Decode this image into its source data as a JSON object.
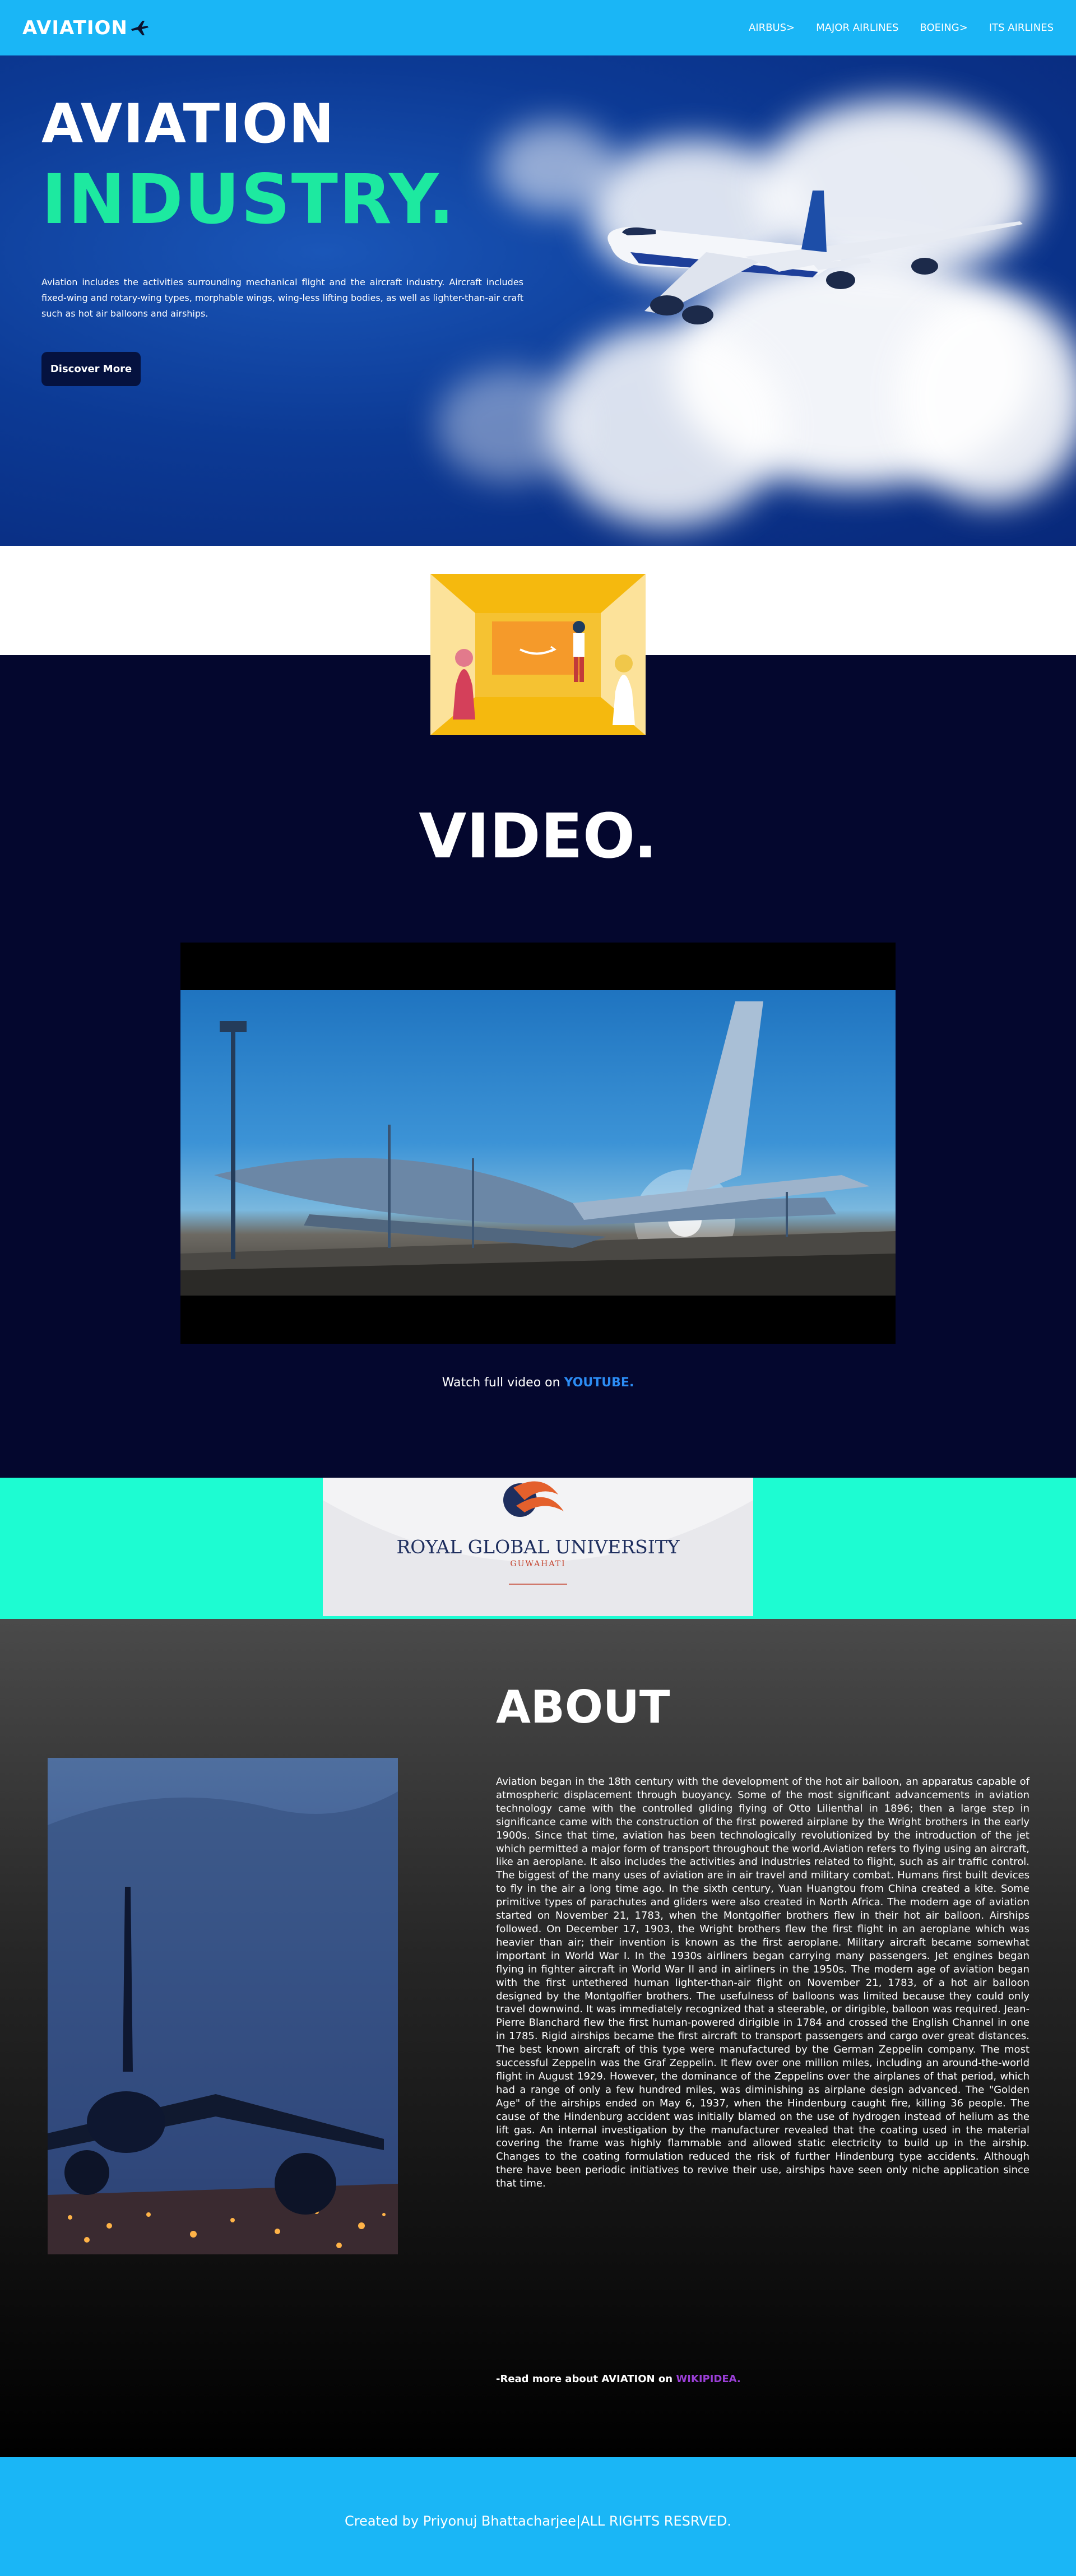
{
  "nav": {
    "brand": "AVIATION",
    "links": [
      "AIRBUS>",
      "MAJOR AIRLINES",
      "BOEING>",
      "ITS AIRLINES"
    ]
  },
  "hero": {
    "title_line1": "AVIATION",
    "title_line2": "INDUSTRY.",
    "description": "Aviation includes the activities surrounding mechanical flight and the aircraft industry. Aircraft includes fixed-wing and rotary-wing types, morphable wings, wing-less lifting bodies, as well as lighter-than-air craft such as hot air balloons and airships.",
    "button_label": "Discover More"
  },
  "video": {
    "title": "VIDEO.",
    "watch_prefix": "Watch full video on ",
    "watch_link": "YOUTUBE."
  },
  "sponsor": {
    "name": "ROYAL GLOBAL UNIVERSITY",
    "city": "GUWAHATI"
  },
  "about": {
    "title": "ABOUT",
    "body": "Aviation began in the 18th century with the development of the hot air balloon, an apparatus capable of atmospheric displacement through buoyancy. Some of the most significant advancements in aviation technology came with the controlled gliding flying of Otto Lilienthal in 1896; then a large step in significance came with the construction of the first powered airplane by the Wright brothers in the early 1900s. Since that time, aviation has been technologically revolutionized by the introduction of the jet which permitted a major form of transport throughout the world.Aviation refers to flying using an aircraft, like an aeroplane. It also includes the activities and industries related to flight, such as air traffic control. The biggest of the many uses of aviation are in air travel and military combat. Humans first built devices to fly in the air a long time ago. In the sixth century, Yuan Huangtou from China created a kite. Some primitive types of parachutes and gliders were also created in North Africa. The modern age of aviation started on November 21, 1783, when the Montgolfier brothers flew in their hot air balloon. Airships followed. On December 17, 1903, the Wright brothers flew the first flight in an aeroplane which was heavier than air; their invention is known as the first aeroplane. Military aircraft became somewhat important in World War I. In the 1930s airliners began carrying many passengers. Jet engines began flying in fighter aircraft in World War II and in airliners in the 1950s. The modern age of aviation began with the first untethered human lighter-than-air flight on November 21, 1783, of a hot air balloon designed by the Montgolfier brothers. The usefulness of balloons was limited because they could only travel downwind. It was immediately recognized that a steerable, or dirigible, balloon was required. Jean-Pierre Blanchard flew the first human-powered dirigible in 1784 and crossed the English Channel in one in 1785. Rigid airships became the first aircraft to transport passengers and cargo over great distances. The best known aircraft of this type were manufactured by the German Zeppelin company. The most successful Zeppelin was the Graf Zeppelin. It flew over one million miles, including an around-the-world flight in August 1929. However, the dominance of the Zeppelins over the airplanes of that period, which had a range of only a few hundred miles, was diminishing as airplane design advanced. The \"Golden Age\" of the airships ended on May 6, 1937, when the Hindenburg caught fire, killing 36 people. The cause of the Hindenburg accident was initially blamed on the use of hydrogen instead of helium as the lift gas. An internal investigation by the manufacturer revealed that the coating used in the material covering the frame was highly flammable and allowed static electricity to build up in the airship. Changes to the coating formulation reduced the risk of further Hindenburg type accidents. Although there have been periodic initiatives to revive their use, airships have seen only niche application since that time.",
    "read_more_prefix": "-Read more about AVIATION on ",
    "read_more_link": "WIKIPIDEA."
  },
  "footer": {
    "text": "Created by Priyonuj Bhattacharjee|ALL RIGHTS RESRVED."
  }
}
